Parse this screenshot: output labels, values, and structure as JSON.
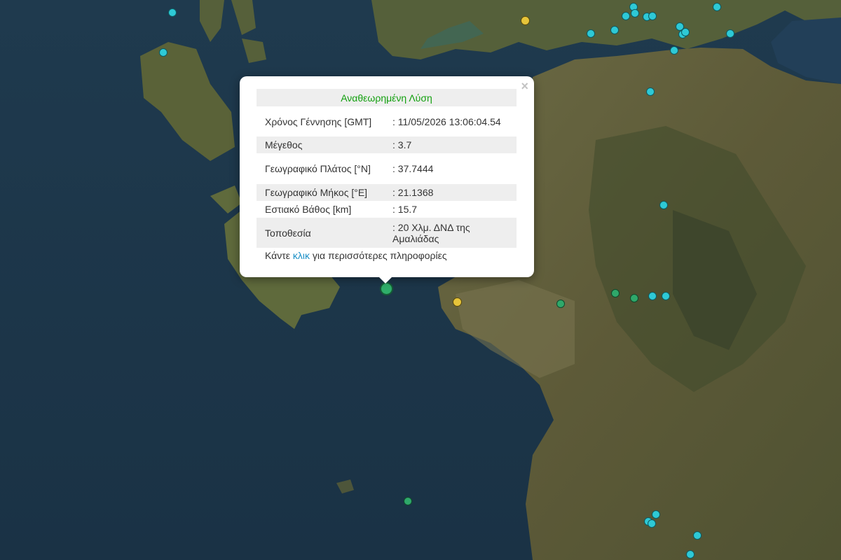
{
  "popup": {
    "header": "Αναθεωρημένη Λύση",
    "close_glyph": "×",
    "rows": [
      {
        "label": "Χρόνος Γέννησης [GMT]",
        "value": ": 11/05/2026 13:06:04.54"
      },
      {
        "label": "Μέγεθος",
        "value": ": 3.7"
      },
      {
        "label": "Γεωγραφικό Πλάτος [°N]",
        "value": ": 37.7444"
      },
      {
        "label": "Γεωγραφικό Μήκος [°E]",
        "value": ": 21.1368"
      },
      {
        "label": "Εστιακό Βάθος [km]",
        "value": ": 15.7"
      },
      {
        "label": "Τοποθεσία",
        "value": ": 20 Χλμ. ΔΝΔ της Αμαλιάδας"
      }
    ],
    "more_prefix": "Κάντε ",
    "more_link": "κλικ",
    "more_suffix": " για περισσότερες πληροφορίες"
  },
  "markers": {
    "colors": {
      "cyan": "#2ec9d6",
      "yellow": "#e6c43a",
      "green": "#2fa86a"
    },
    "selected_event": {
      "type": "green",
      "magnitude": "3.7"
    }
  }
}
